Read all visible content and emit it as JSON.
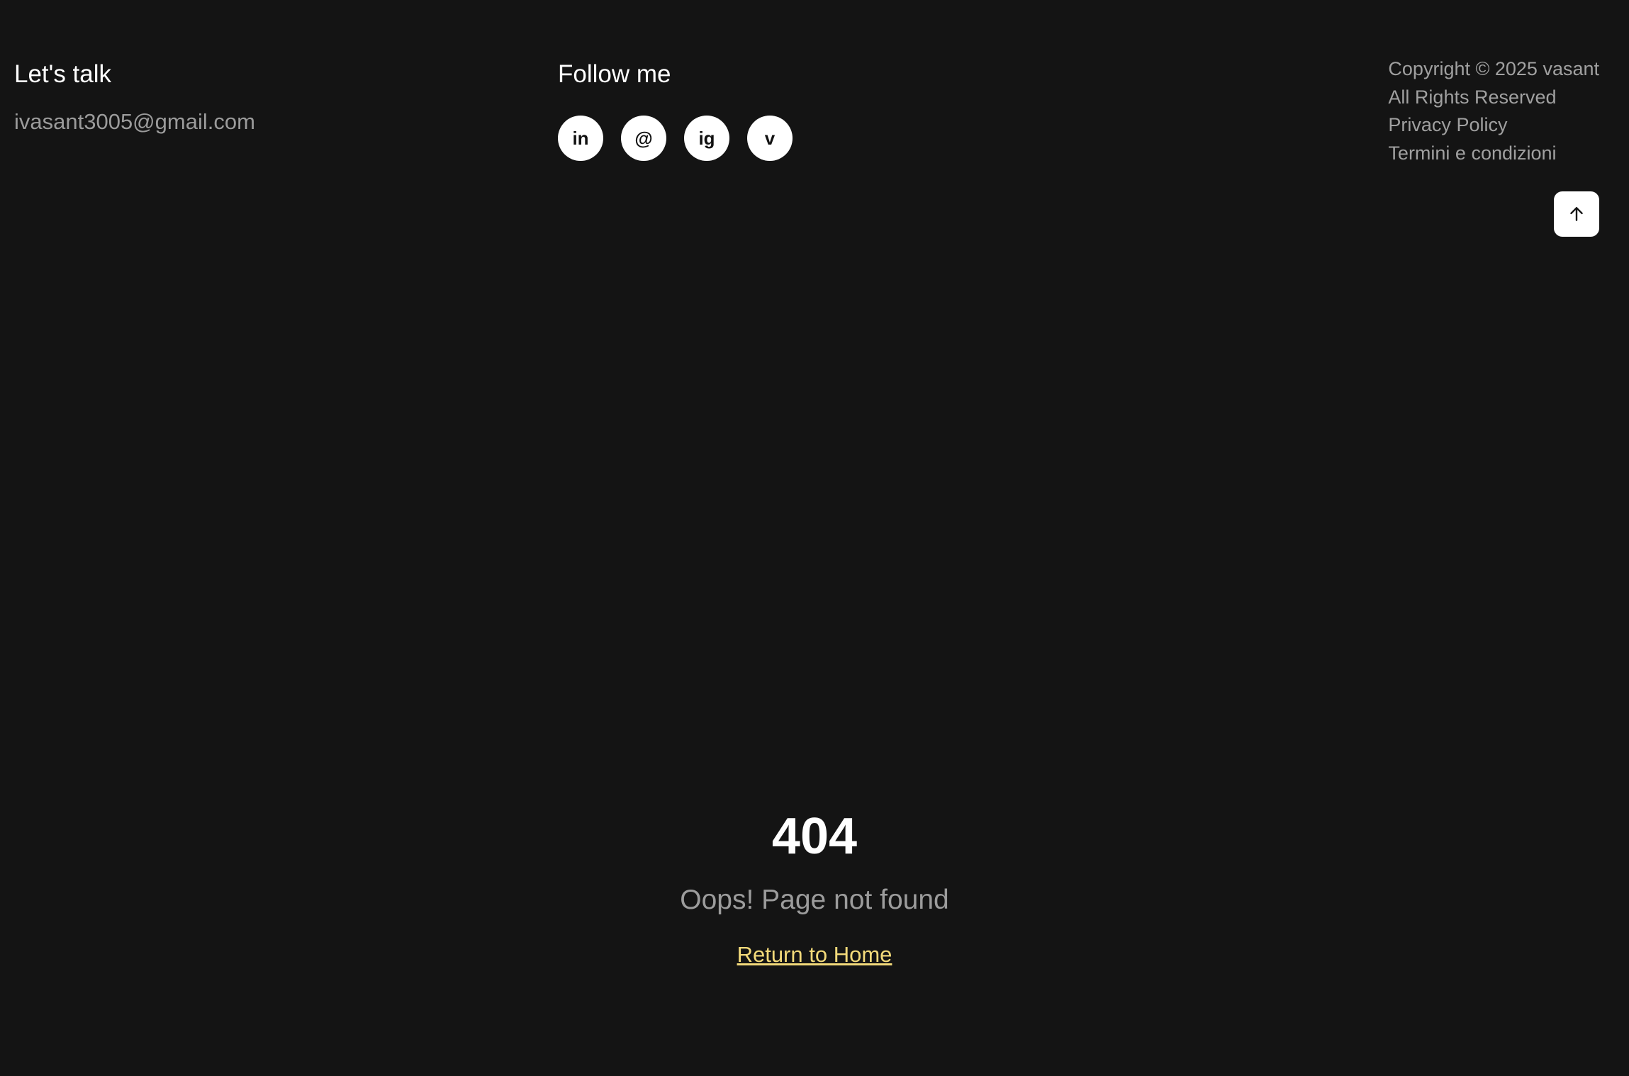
{
  "footer": {
    "talk": {
      "title": "Let's talk",
      "email": "ivasant3005@gmail.com"
    },
    "follow": {
      "title": "Follow me",
      "socials": [
        {
          "label": "in",
          "icon": "linkedin-icon"
        },
        {
          "label": "@",
          "icon": "threads-icon"
        },
        {
          "label": "ig",
          "icon": "instagram-icon"
        },
        {
          "label": "v",
          "icon": "vimeo-icon"
        }
      ]
    },
    "legal": {
      "copyright": "Copyright © 2025 vasant",
      "rights": "All Rights Reserved",
      "privacy": "Privacy Policy",
      "terms": "Termini e condizioni"
    },
    "back_to_top_icon": "arrow-up-icon"
  },
  "not_found": {
    "code": "404",
    "message": "Oops! Page not found",
    "home_link": "Return to Home"
  },
  "colors": {
    "background": "#141414",
    "accent_link": "#f3da7a",
    "muted_text": "#9b9b9b",
    "button_bg": "#ffffff"
  }
}
